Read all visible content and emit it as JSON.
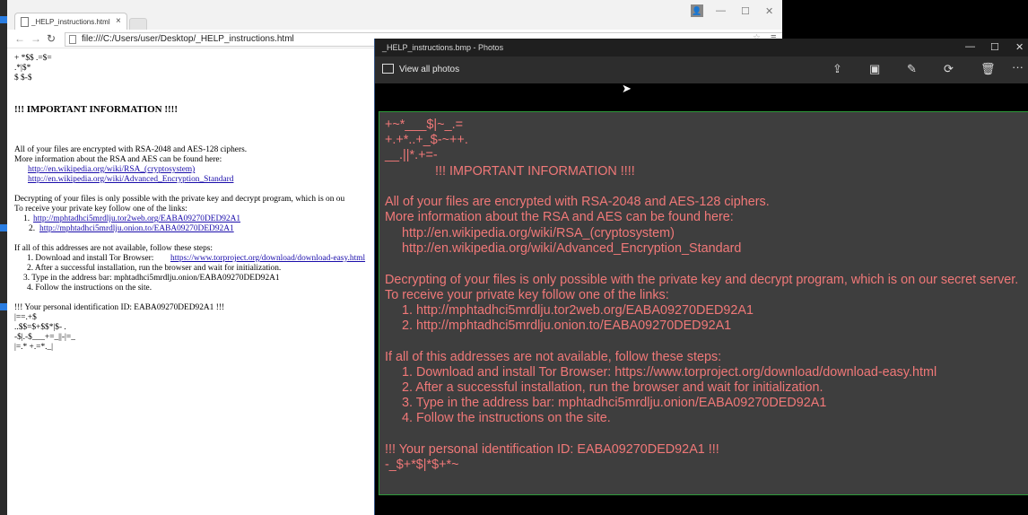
{
  "browser": {
    "tab_title": "_HELP_instructions.html",
    "tab_close": "×",
    "url": "file:///C:/Users/user/Desktop/_HELP_instructions.html",
    "window_min": "—",
    "window_max": "☐",
    "window_close": "✕"
  },
  "page": {
    "art": [
      "+ *$$ .=$=",
      ".*|$*",
      "$ $-$"
    ],
    "heading": "!!! IMPORTANT INFORMATION !!!!",
    "p1": "All of your files are encrypted with RSA-2048 and AES-128 ciphers.",
    "p2": "More information about the RSA and AES can be found here:",
    "link_rsa": "http://en.wikipedia.org/wiki/RSA_(cryptosystem)",
    "link_aes": "http://en.wikipedia.org/wiki/Advanced_Encryption_Standard",
    "p3": "Decrypting of your files is only possible with the private key and decrypt program, which is on ou",
    "p4": "To receive your private key follow one of the links:",
    "l1_num": "1.",
    "l1": "http://mphtadhci5mrdlju.tor2web.org/EABA09270DED92A1",
    "l2_num": "2.",
    "l2": "http://mphtadhci5mrdlju.onion.to/EABA09270DED92A1",
    "p5": "If all of this addresses are not available, follow these steps:",
    "s1_pre": "1. Download and install Tor Browser: ",
    "s1_link": "https://www.torproject.org/download/download-easy.html",
    "s2": "2. After a successful installation, run the browser and wait for initialization.",
    "s3": "3. Type in the address bar: mphtadhci5mrdlju.onion/EABA09270DED92A1",
    "s4": "4. Follow the instructions on the site.",
    "id_line": "!!! Your personal identification ID: EABA09270DED92A1 !!!",
    "art2": [
      "|==.+$",
      "..$$=$+$$*|$- .",
      "-$|.-$___+=_||-|=_",
      "|=.* +.=*._|"
    ]
  },
  "photos": {
    "title": "_HELP_instructions.bmp - Photos",
    "view_all": "View all photos",
    "min": "—",
    "max": "☐",
    "close": "✕",
    "more": "···",
    "image_lines": [
      "+~*___$|~_.=",
      "+.+*..+_$-~++.",
      "__.||*.+=-",
      "!!! IMPORTANT INFORMATION !!!!",
      "All of your files are encrypted with RSA-2048 and AES-128 ciphers.",
      "More information about the RSA and AES can be found here:",
      "http://en.wikipedia.org/wiki/RSA_(cryptosystem)",
      "http://en.wikipedia.org/wiki/Advanced_Encryption_Standard",
      "Decrypting of your files is only possible with the private key and decrypt program, which is on our secret server.",
      "To receive your private key follow one of the links:",
      "1. http://mphtadhci5mrdlju.tor2web.org/EABA09270DED92A1",
      "2. http://mphtadhci5mrdlju.onion.to/EABA09270DED92A1",
      "If all of this addresses are not available, follow these steps:",
      "1. Download and install Tor Browser: https://www.torproject.org/download/download-easy.html",
      "2. After a successful installation, run the browser and wait for initialization.",
      "3. Type in the address bar: mphtadhci5mrdlju.onion/EABA09270DED92A1",
      "4. Follow the instructions on the site.",
      "!!! Your personal identification ID: EABA09270DED92A1 !!!",
      "-_$+*$|*$+*~"
    ]
  },
  "colors": {
    "ransom_text": "#f07878",
    "image_bg": "#3e3e3e",
    "image_border": "#2e9a3a",
    "link": "#1a0dab"
  }
}
